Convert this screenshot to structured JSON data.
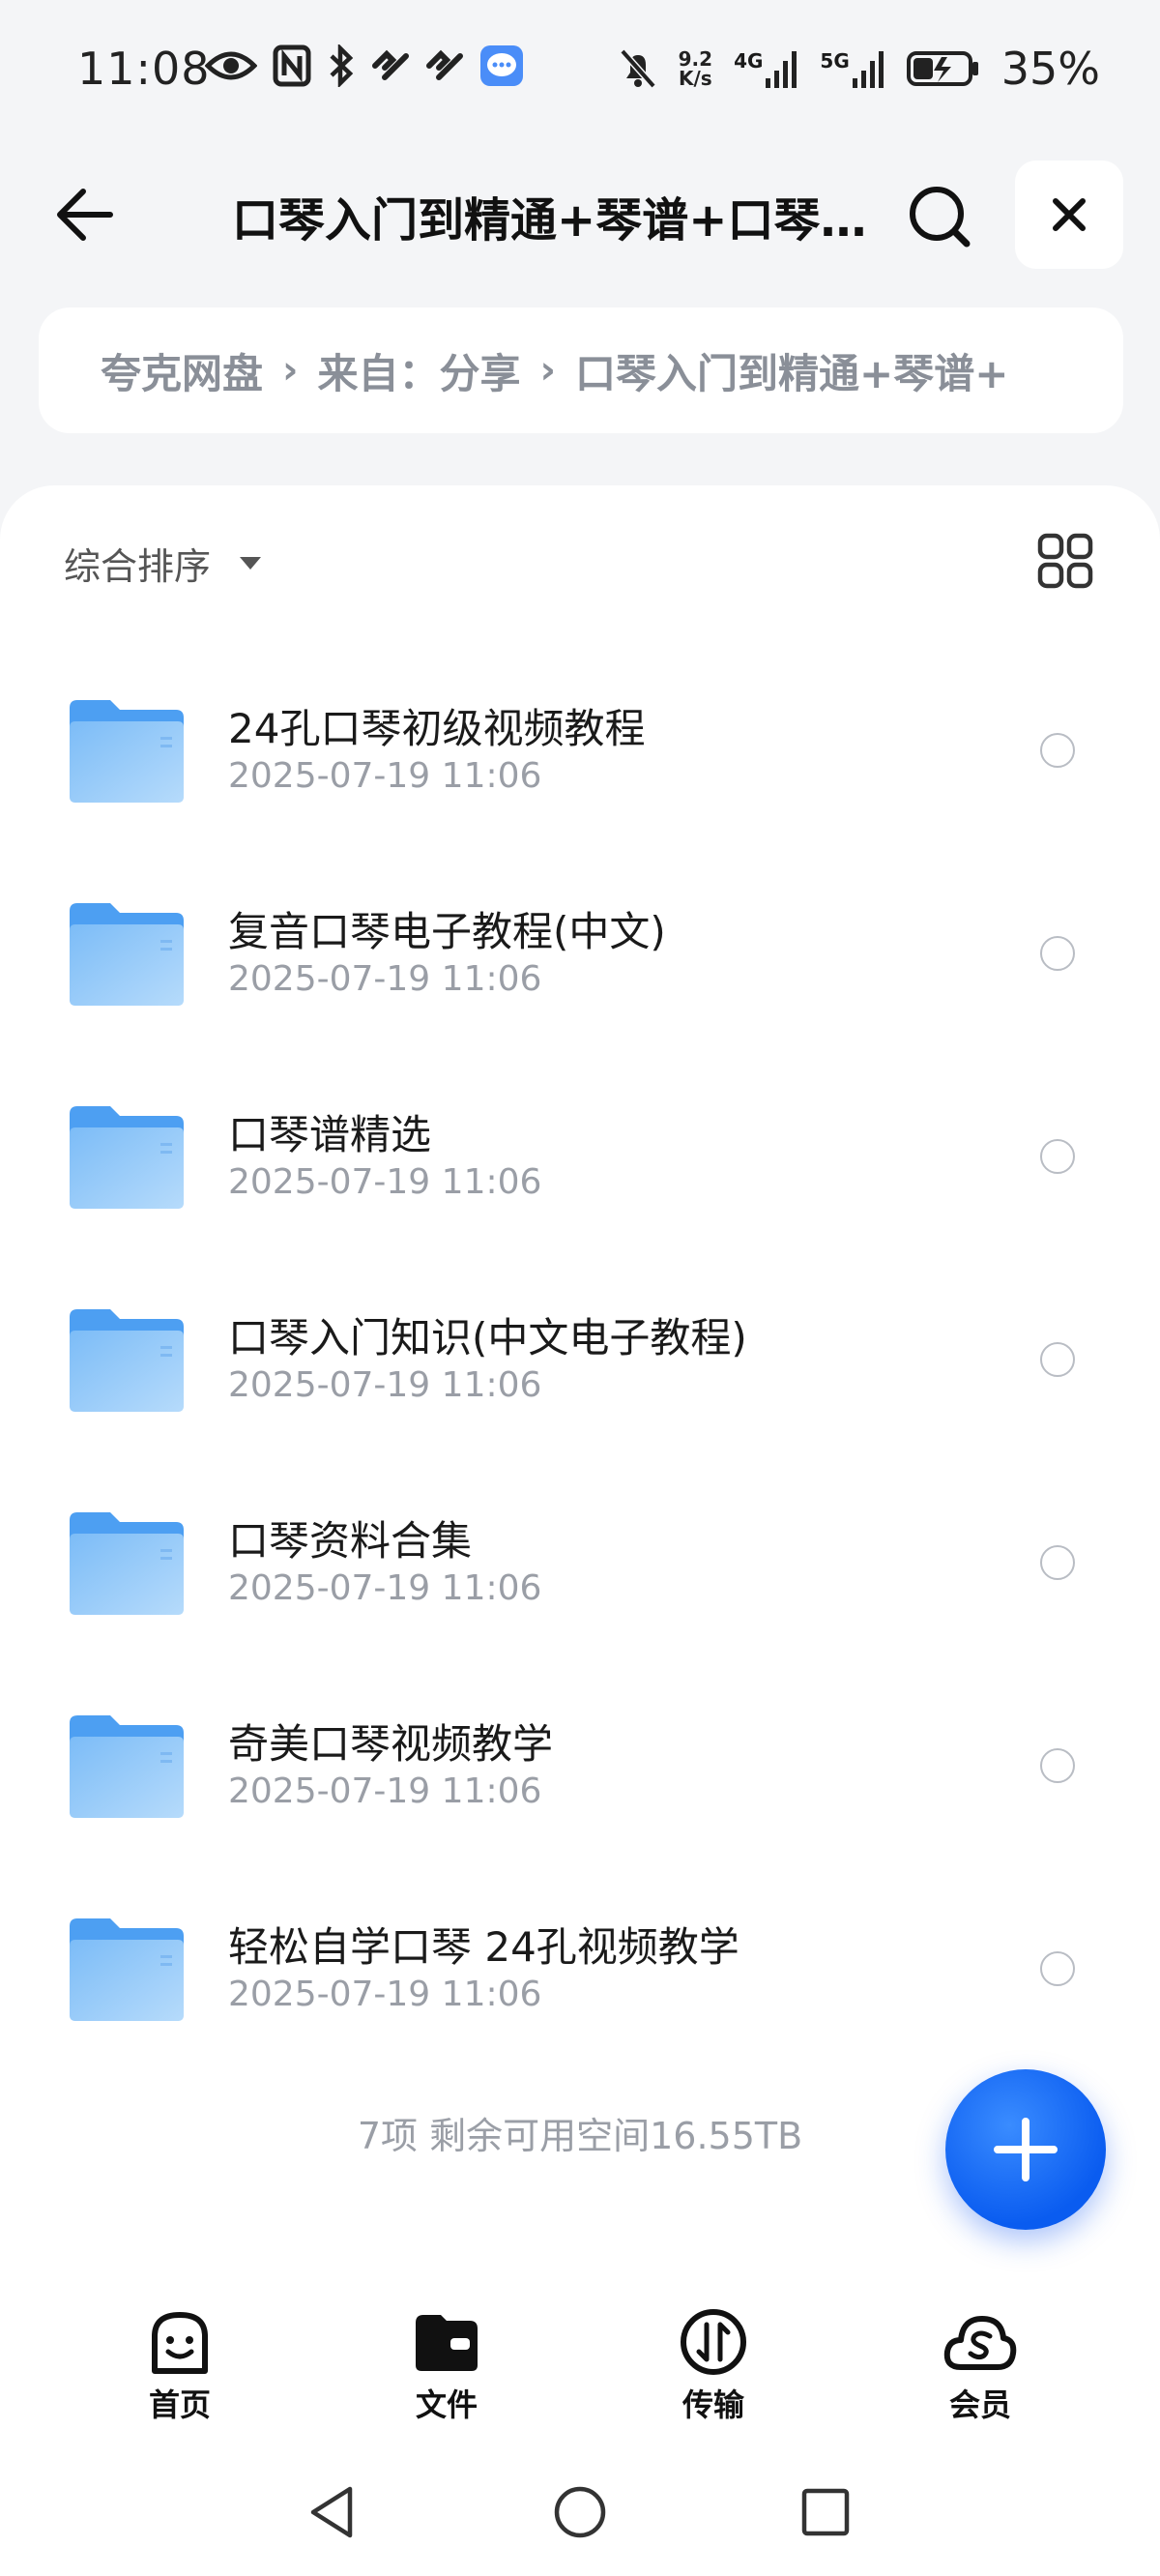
{
  "status_bar": {
    "time": "11:08",
    "net_speed_value": "9.2",
    "net_speed_unit": "K/s",
    "signal1_label": "4G",
    "signal2_label": "5G",
    "battery": "35%"
  },
  "header": {
    "title": "口琴入门到精通+琴谱+口琴演奏视频教程",
    "icons": [
      "back-arrow-icon",
      "search-icon",
      "close-icon"
    ]
  },
  "breadcrumb": {
    "items": [
      "夸克网盘",
      "来自：分享",
      "口琴入门到精通+琴谱+"
    ]
  },
  "toolbar": {
    "sort_label": "综合排序"
  },
  "files": [
    {
      "name": "24孔口琴初级视频教程",
      "date": "2025-07-19 11:06"
    },
    {
      "name": "复音口琴电子教程(中文)",
      "date": "2025-07-19 11:06"
    },
    {
      "name": "口琴谱精选",
      "date": "2025-07-19 11:06"
    },
    {
      "name": "口琴入门知识(中文电子教程)",
      "date": "2025-07-19 11:06"
    },
    {
      "name": "口琴资料合集",
      "date": "2025-07-19 11:06"
    },
    {
      "name": "奇美口琴视频教学",
      "date": "2025-07-19 11:06"
    },
    {
      "name": "轻松自学口琴 24孔视频教学",
      "date": "2025-07-19 11:06"
    }
  ],
  "footer": {
    "summary": "7项 剩余可用空间16.55TB"
  },
  "bottom_nav": {
    "items": [
      {
        "label": "首页",
        "icon": "smiley-icon"
      },
      {
        "label": "文件",
        "icon": "folder-wallet-icon"
      },
      {
        "label": "传输",
        "icon": "transfer-icon"
      },
      {
        "label": "会员",
        "icon": "cloud-s-icon"
      }
    ],
    "active_index": 1
  },
  "colors": {
    "accent": "#0a5cf0",
    "folder": "#5aa8f5",
    "background": "#f4f5f7"
  }
}
